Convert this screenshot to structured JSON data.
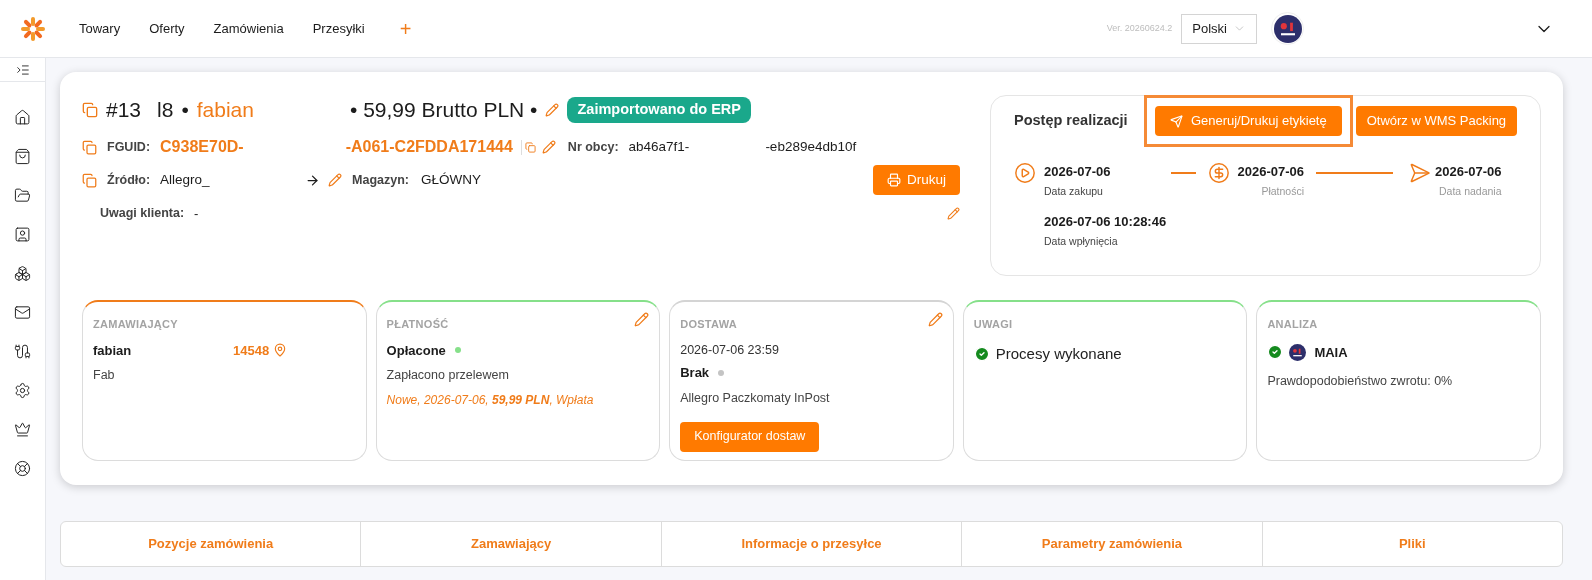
{
  "nav": {
    "items": [
      "Towary",
      "Oferty",
      "Zamówienia",
      "Przesyłki"
    ],
    "add": "+",
    "version": "Ver. 20260624.2",
    "language": "Polski"
  },
  "order": {
    "number_start": "#13",
    "number_end": "l8",
    "separator": "•",
    "customer": "fabian",
    "amount": "• 59,99 Brutto PLN •",
    "badge": "Zaimportowano do ERP",
    "fguid_label": "FGUID:",
    "fguid_start": "C938E70D-",
    "fguid_end": "-A061-C2FDDA171444",
    "foreign_label": "Nr obcy:",
    "foreign_start": "ab46a7f1-",
    "foreign_end": "-eb289e4db10f",
    "source_label": "Źródło:",
    "source": "Allegro_",
    "warehouse_label": "Magazyn:",
    "warehouse": "GŁÓWNY",
    "print": "Drukuj",
    "notes_label": "Uwagi klienta:",
    "notes": "-"
  },
  "progress": {
    "title": "Postęp realizacji",
    "label_button": {
      "text": "Generuj/Drukuj etykietę",
      "highlighted": true
    },
    "wms_button": "Otwórz w WMS Packing",
    "steps": [
      {
        "kind": "play",
        "date": "2026-07-06",
        "label": "Data zakupu",
        "done": true
      },
      {
        "kind": "dollar",
        "date": "2026-07-06",
        "label": "Płatności",
        "done": false
      },
      {
        "kind": "send",
        "date": "2026-07-06",
        "label": "Data nadania",
        "done": false
      }
    ],
    "received": {
      "date": "2026-07-06 10:28:46",
      "label": "Data wpłynięcia"
    }
  },
  "cards": [
    {
      "kind": "customer",
      "title": "ZAMAWIAJĄCY",
      "color": "#f07c1a",
      "name": "fabian",
      "phone": "14548",
      "sub": "Fab"
    },
    {
      "kind": "payment",
      "title": "PŁATNOŚĆ",
      "color": "#86e08a",
      "status": "Opłacone",
      "status_dot": {
        "color": "#86e08a"
      },
      "method": "Zapłacono przelewem",
      "detail": "Nowe, 2026-07-06, **59,99 PLN**, Wpłata"
    },
    {
      "kind": "delivery",
      "title": "DOSTAWA",
      "color": "#d4d4d4",
      "date": "2026-07-06 23:59",
      "status": "Brak",
      "status_dot": {
        "color": "#c4c4c4"
      },
      "carrier": "Allegro Paczkomaty InPost",
      "button": "Konfigurator dostaw"
    },
    {
      "kind": "notes",
      "title": "UWAGI",
      "color": "#86e08a",
      "text": "Procesy wykonane"
    },
    {
      "kind": "analysis",
      "title": "ANALIZA",
      "color": "#86e08a",
      "name": "MAIA",
      "text": "Prawdopodobieństwo zwrotu: 0%"
    }
  ],
  "tabs": [
    {
      "label": "Pozycje zamówienia",
      "selected": false
    },
    {
      "label": "Zamawiający",
      "selected": false
    },
    {
      "label": "Informacje o przesyłce",
      "selected": false
    },
    {
      "label": "Parametry zamówienia",
      "selected": false
    },
    {
      "label": "Pliki",
      "selected": false
    }
  ]
}
